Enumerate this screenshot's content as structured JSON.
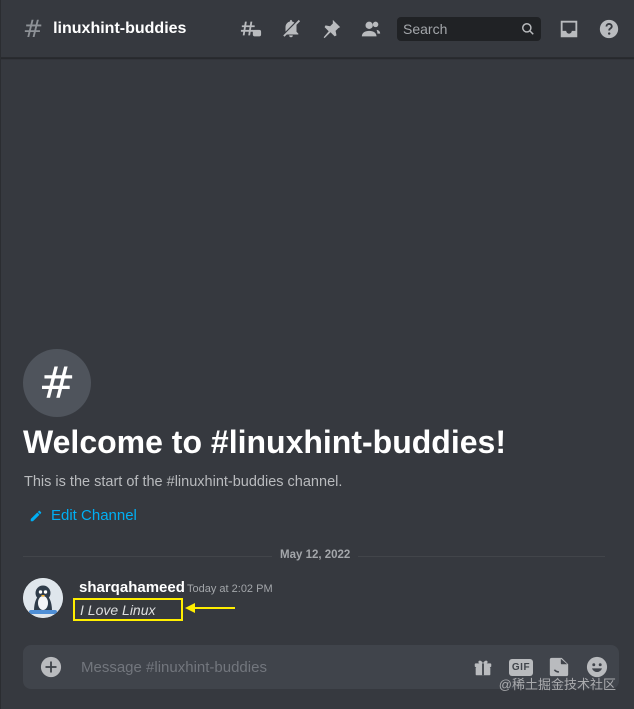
{
  "header": {
    "hash_glyph": "#",
    "channel_name": "linuxhint-buddies",
    "search_placeholder": "Search",
    "icons": [
      "threads-icon",
      "notification-muted-icon",
      "pin-icon",
      "member-list-icon",
      "search-icon",
      "inbox-icon",
      "help-icon"
    ]
  },
  "welcome": {
    "hash_glyph": "#",
    "title": "Welcome to #linuxhint-buddies!",
    "subtitle": "This is the start of the #linuxhint-buddies channel.",
    "edit_channel_label": "Edit Channel"
  },
  "messages": {
    "date_divider": "May 12, 2022",
    "items": [
      {
        "author": "sharqahameed",
        "timestamp": "Today at 2:02 PM",
        "text": "I Love Linux"
      }
    ]
  },
  "composer": {
    "placeholder": "Message #linuxhint-buddies",
    "gif_label": "GIF",
    "icons": [
      "add-attachment-icon",
      "gift-icon",
      "gif-icon",
      "sticker-icon",
      "emoji-icon"
    ]
  },
  "annotation": {
    "highlight_color": "#ffee00"
  },
  "watermark": "@稀土掘金技术社区",
  "colors": {
    "background": "#36393f",
    "header_text": "#ffffff",
    "muted_text": "#b9bbbe",
    "link": "#00aff4",
    "composer_bg": "#40444b",
    "search_bg": "#202225"
  }
}
